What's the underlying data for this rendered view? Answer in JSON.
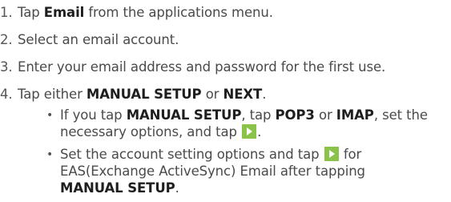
{
  "steps": [
    {
      "num": "1.",
      "pre": "Tap ",
      "bold": "Email",
      "post": " from the applications menu."
    },
    {
      "num": "2.",
      "text": "Select an email account."
    },
    {
      "num": "3.",
      "text": "Enter your email address and password for the first use."
    },
    {
      "num": "4.",
      "pre": "Tap either ",
      "bold1": "MANUAL SETUP",
      "mid": " or ",
      "bold2": "NEXT",
      "post": "."
    }
  ],
  "bullet_char": "•",
  "sub1": {
    "pre": "If you tap ",
    "bold1": "MANUAL SETUP",
    "mid1": ", tap ",
    "bold2": "POP3",
    "mid2": " or ",
    "bold3": "IMAP",
    "mid3": ", set the",
    "line2_pre": "necessary options, and tap ",
    "line2_post": "."
  },
  "sub2": {
    "pre": "Set the account setting options and tap ",
    "post": " for",
    "line2": "EAS(Exchange ActiveSync) Email after tapping",
    "line3_bold": "MANUAL SETUP",
    "line3_post": "."
  },
  "icons": {
    "next_icon": "play-arrow-icon",
    "next_icon_color": "#8bc34a"
  }
}
